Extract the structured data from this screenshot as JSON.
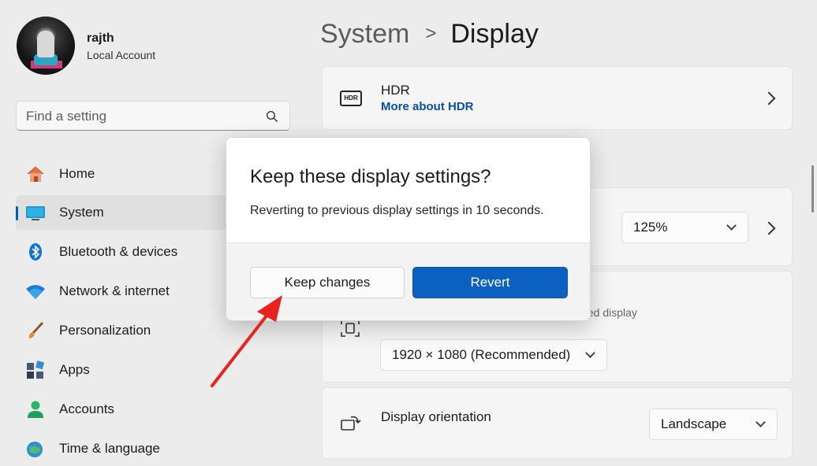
{
  "user": {
    "name": "rajth",
    "account": "Local Account"
  },
  "search": {
    "placeholder": "Find a setting"
  },
  "sidebar": {
    "items": [
      {
        "label": "Home",
        "icon": "home-icon"
      },
      {
        "label": "System",
        "icon": "system-icon",
        "active": true
      },
      {
        "label": "Bluetooth & devices",
        "icon": "bluetooth-icon"
      },
      {
        "label": "Network & internet",
        "icon": "wifi-icon"
      },
      {
        "label": "Personalization",
        "icon": "brush-icon"
      },
      {
        "label": "Apps",
        "icon": "apps-icon"
      },
      {
        "label": "Accounts",
        "icon": "accounts-icon"
      },
      {
        "label": "Time & language",
        "icon": "globe-icon"
      }
    ]
  },
  "breadcrumb": {
    "parent": "System",
    "separator": ">",
    "current": "Display"
  },
  "main": {
    "hdr": {
      "badge": "HDR",
      "title": "HDR",
      "link": "More about HDR"
    },
    "scale": {
      "value": "125%"
    },
    "resolution": {
      "partial_text": "ted display",
      "value": "1920 × 1080 (Recommended)"
    },
    "orientation": {
      "label": "Display orientation",
      "value": "Landscape"
    }
  },
  "dialog": {
    "title": "Keep these display settings?",
    "message": "Reverting to previous display settings in 10 seconds.",
    "keep_label": "Keep changes",
    "revert_label": "Revert"
  },
  "colors": {
    "accent": "#0b60c0",
    "annotation_arrow": "#e8231f",
    "link": "#0a4fa0"
  }
}
